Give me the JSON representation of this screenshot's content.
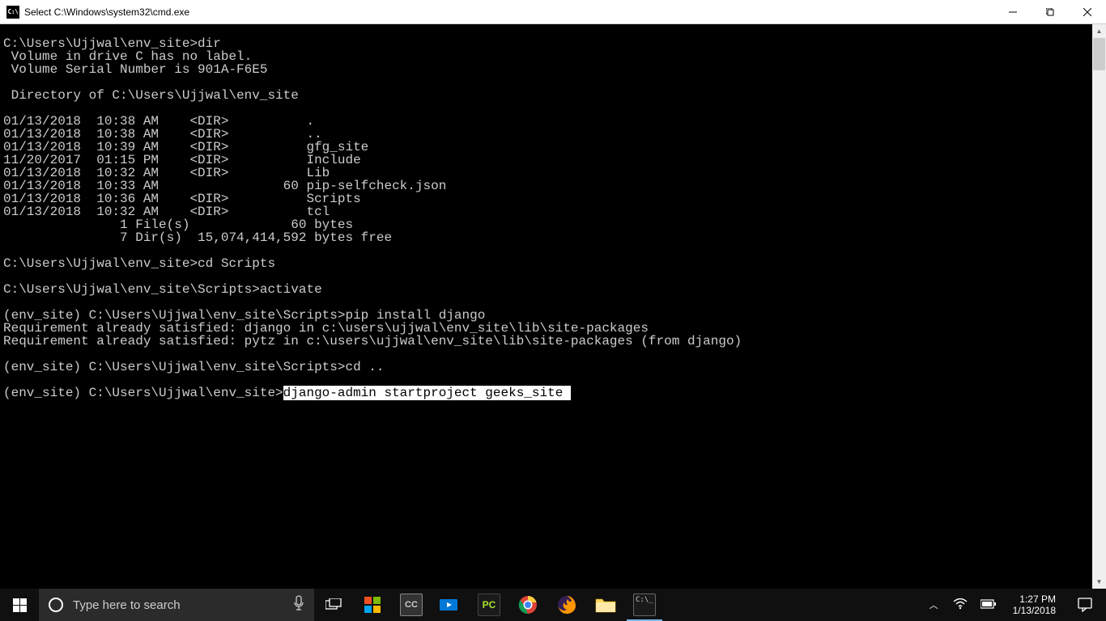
{
  "window": {
    "title": "Select C:\\Windows\\system32\\cmd.exe",
    "icon_label": "C:\\"
  },
  "terminal": {
    "line01": "",
    "line02": "C:\\Users\\Ujjwal\\env_site>dir",
    "line03": " Volume in drive C has no label.",
    "line04": " Volume Serial Number is 901A-F6E5",
    "line05": "",
    "line06": " Directory of C:\\Users\\Ujjwal\\env_site",
    "line07": "",
    "line08": "01/13/2018  10:38 AM    <DIR>          .",
    "line09": "01/13/2018  10:38 AM    <DIR>          ..",
    "line10": "01/13/2018  10:39 AM    <DIR>          gfg_site",
    "line11": "11/20/2017  01:15 PM    <DIR>          Include",
    "line12": "01/13/2018  10:32 AM    <DIR>          Lib",
    "line13": "01/13/2018  10:33 AM                60 pip-selfcheck.json",
    "line14": "01/13/2018  10:36 AM    <DIR>          Scripts",
    "line15": "01/13/2018  10:32 AM    <DIR>          tcl",
    "line16": "               1 File(s)             60 bytes",
    "line17": "               7 Dir(s)  15,074,414,592 bytes free",
    "line18": "",
    "line19": "C:\\Users\\Ujjwal\\env_site>cd Scripts",
    "line20": "",
    "line21": "C:\\Users\\Ujjwal\\env_site\\Scripts>activate",
    "line22": "",
    "line23": "(env_site) C:\\Users\\Ujjwal\\env_site\\Scripts>pip install django",
    "line24": "Requirement already satisfied: django in c:\\users\\ujjwal\\env_site\\lib\\site-packages",
    "line25": "Requirement already satisfied: pytz in c:\\users\\ujjwal\\env_site\\lib\\site-packages (from django)",
    "line26": "",
    "line27": "(env_site) C:\\Users\\Ujjwal\\env_site\\Scripts>cd ..",
    "line28": "",
    "prompt29": "(env_site) C:\\Users\\Ujjwal\\env_site>",
    "selected29": "django-admin startproject geeks_site "
  },
  "taskbar": {
    "search_placeholder": "Type here to search",
    "time": "1:27 PM",
    "date": "1/13/2018"
  }
}
